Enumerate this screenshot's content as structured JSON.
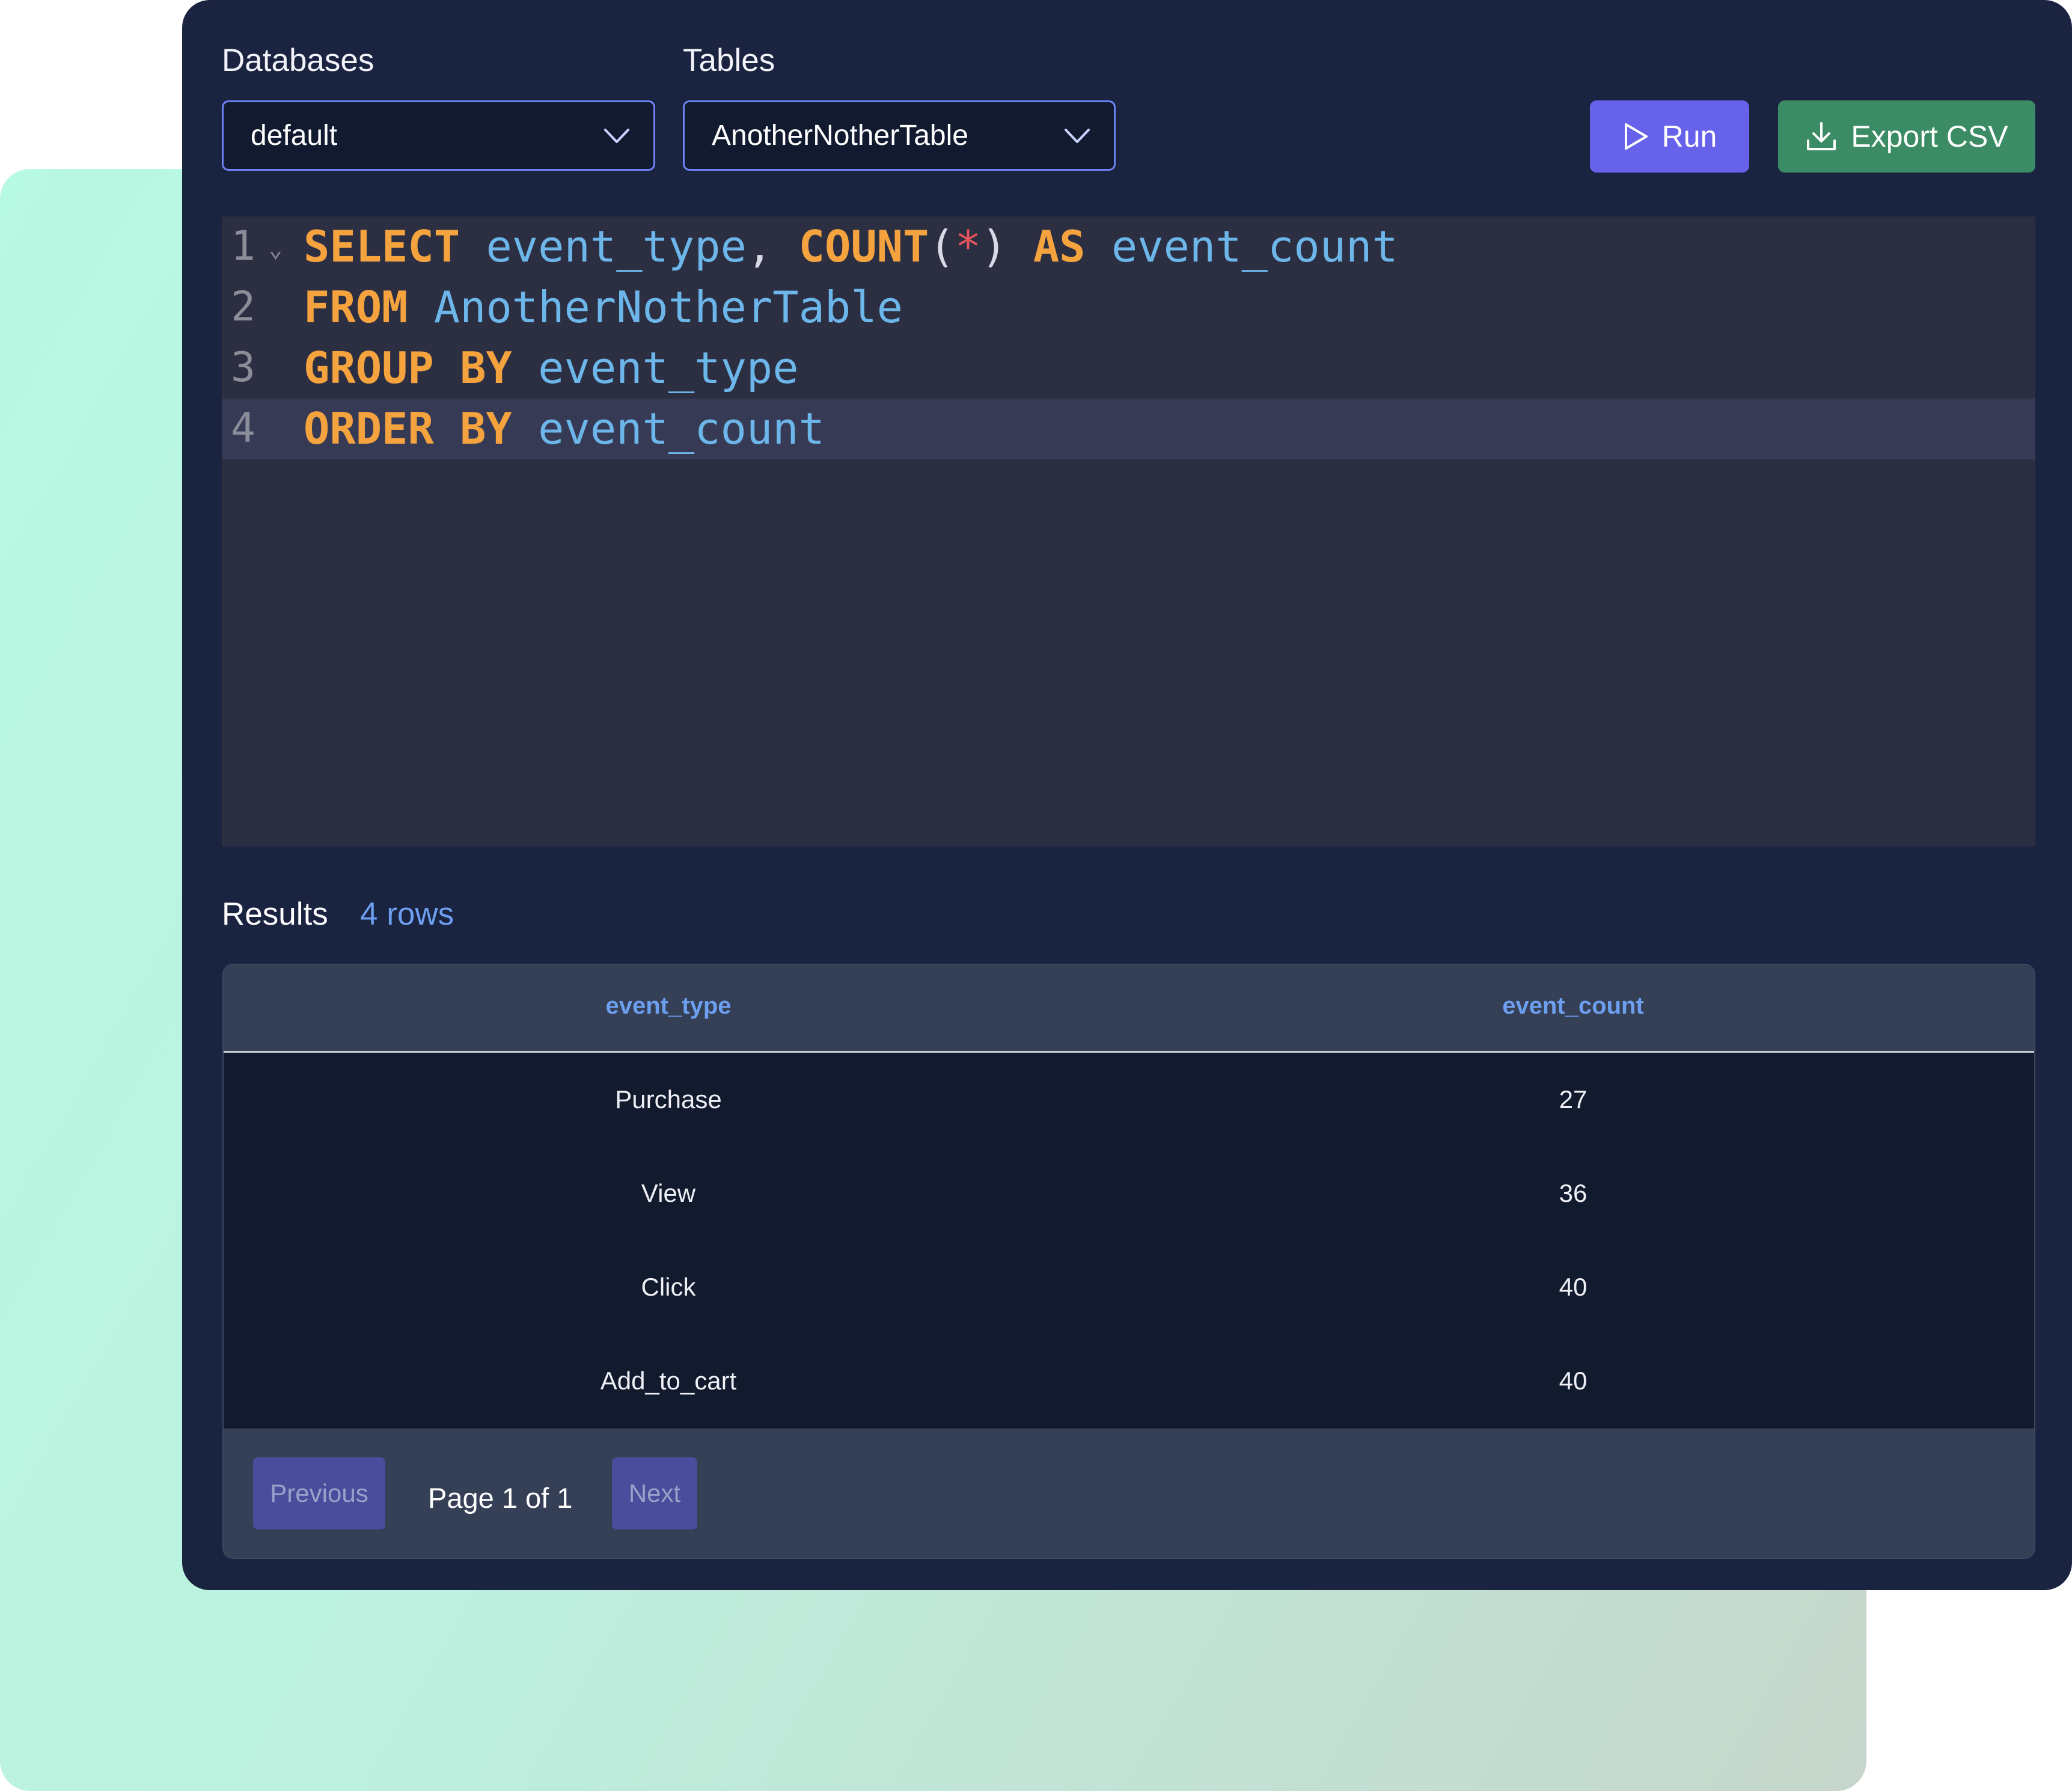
{
  "toolbar": {
    "databases_label": "Databases",
    "databases_selected": "default",
    "tables_label": "Tables",
    "tables_selected": "AnotherNotherTable",
    "run_label": "Run",
    "export_label": "Export CSV"
  },
  "editor": {
    "lines": [
      {
        "number": "1",
        "tokens": [
          [
            "kw",
            "SELECT"
          ],
          [
            "sp",
            " "
          ],
          [
            "id",
            "event_type"
          ],
          [
            "p",
            ", "
          ],
          [
            "kw",
            "COUNT"
          ],
          [
            "p",
            "("
          ],
          [
            "star",
            "*"
          ],
          [
            "p",
            ") "
          ],
          [
            "kw",
            "AS"
          ],
          [
            "sp",
            " "
          ],
          [
            "id",
            "event_count"
          ]
        ]
      },
      {
        "number": "2",
        "tokens": [
          [
            "kw",
            "FROM"
          ],
          [
            "sp",
            " "
          ],
          [
            "id",
            "AnotherNotherTable"
          ]
        ]
      },
      {
        "number": "3",
        "tokens": [
          [
            "kw",
            "GROUP BY"
          ],
          [
            "sp",
            " "
          ],
          [
            "id",
            "event_type"
          ]
        ]
      },
      {
        "number": "4",
        "tokens": [
          [
            "kw",
            "ORDER BY"
          ],
          [
            "sp",
            " "
          ],
          [
            "id",
            "event_count"
          ]
        ]
      }
    ],
    "fold_glyph": "⌄"
  },
  "results": {
    "title": "Results",
    "count": "4 rows",
    "columns": [
      "event_type",
      "event_count"
    ],
    "rows": [
      [
        "Purchase",
        "27"
      ],
      [
        "View",
        "36"
      ],
      [
        "Click",
        "40"
      ],
      [
        "Add_to_cart",
        "40"
      ]
    ]
  },
  "pagination": {
    "previous_label": "Previous",
    "page_info": "Page 1 of 1",
    "next_label": "Next"
  },
  "colors": {
    "panel": "#1a2340",
    "keyword": "#f5a33e",
    "identifier": "#6cb6ea",
    "run_button": "#6762ea",
    "export_button": "#3b8c65",
    "accent_text": "#6d9ff0"
  },
  "icons": [
    "chevron-down-icon",
    "play-icon",
    "download-icon"
  ]
}
